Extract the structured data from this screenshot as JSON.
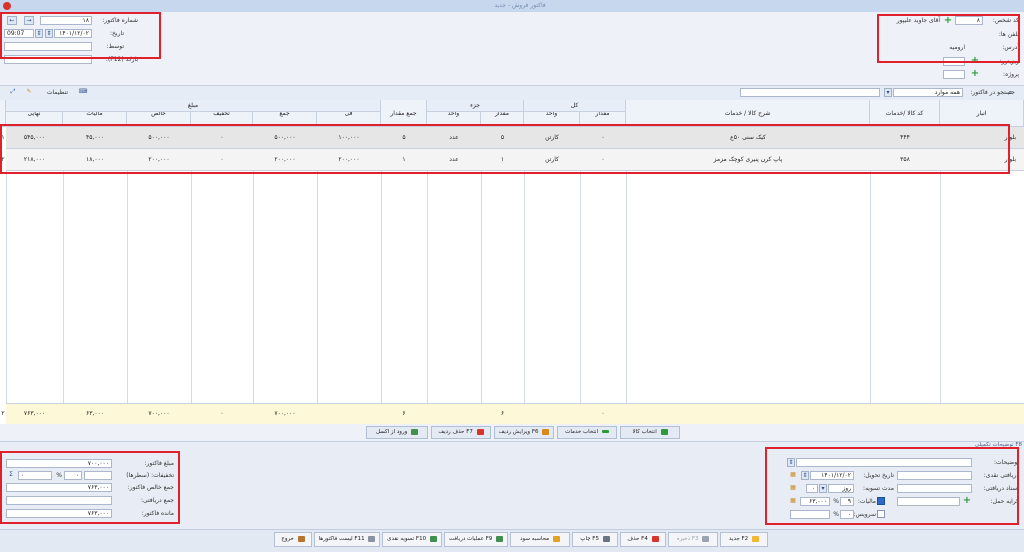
{
  "window": {
    "title": "فاکتور فروش - جدید"
  },
  "header": {
    "invoice_number_label": "شماره فاکتور:",
    "invoice_number": "۱۸",
    "date_label": "تاریخ:",
    "date": "۱۴۰۱/۱۲/۰۲",
    "time": "09:07",
    "by_label": "توسط:",
    "by": "",
    "barcode_label": "بارکد (F12):",
    "barcode": "",
    "person_code_label": "کد شخص:",
    "person_code": "۸",
    "person_name": "آقای جاوید علیپور",
    "phones_label": "تلفن ها:",
    "phones": "",
    "address_label": "آدرس:",
    "address": "ارومیه",
    "visitor_label": "ویزیتور:",
    "visitor": "",
    "project_label": "پروژه:",
    "project": ""
  },
  "searchbar": {
    "settings_label": "تنظیمات",
    "search_label": "جستجو در فاکتور:",
    "scope_value": "همه موارد"
  },
  "table": {
    "group_headers": {
      "kol": "کل",
      "jozz": "جزء",
      "mablagh": "مبلغ"
    },
    "columns": {
      "anbar": "انبار",
      "code": "کد کالا /خدمات",
      "sharh": "شرح کالا / خدمات",
      "kol_megdar": "مقدار",
      "kol_vahed": "واحد",
      "jozz_megdar": "مقدار",
      "jozz_vahed": "واحد",
      "jam_megdar": "جمع مقدار",
      "fi": "فی",
      "jam": "جمع",
      "takhfif": "تخفیف",
      "khales": "خالص",
      "maliat": "مالیات",
      "nahaei": "نهایی"
    },
    "rows": [
      {
        "num": "۱",
        "anbar": "بلوار",
        "code": "۴۴۴",
        "sharh": "کیک سنی ۵۰ع",
        "kol_megdar": "۰",
        "kol_vahed": "کارتن",
        "jozz_megdar": "۵",
        "jozz_vahed": "عدد",
        "jam_megdar": "۵",
        "fi": "۱۰۰,۰۰۰",
        "jam": "۵۰۰,۰۰۰",
        "takhfif": "۰",
        "khales": "۵۰۰,۰۰۰",
        "maliat": "۴۵,۰۰۰",
        "nahaei": "۵۴۵,۰۰۰"
      },
      {
        "num": "۲",
        "anbar": "بلوار",
        "code": "۳۵۸",
        "sharh": "پاپ کرن پنیری کوچک مزمز",
        "kol_megdar": "۰",
        "kol_vahed": "کارتن",
        "jozz_megdar": "۱",
        "jozz_vahed": "عدد",
        "jam_megdar": "۱",
        "fi": "۲۰۰,۰۰۰",
        "jam": "۲۰۰,۰۰۰",
        "takhfif": "۰",
        "khales": "۲۰۰,۰۰۰",
        "maliat": "۱۸,۰۰۰",
        "nahaei": "۲۱۸,۰۰۰"
      }
    ],
    "totals": {
      "count": "۲",
      "kol_megdar": "۰",
      "jozz_megdar": "۶",
      "jam_megdar": "۶",
      "jam": "۷۰۰,۰۰۰",
      "takhfif": "۰",
      "khales": "۷۰۰,۰۰۰",
      "maliat": "۶۳,۰۰۰",
      "nahaei": "۷۶۳,۰۰۰"
    }
  },
  "row_toolbar": {
    "select_goods": "انتخاب کالا",
    "select_services": "انتخاب خدمات",
    "edit_row": "ویرایش ردیف F6",
    "delete_row": "حذف ردیف F7",
    "import_excel": "ورود از اکسل"
  },
  "summary": {
    "amount_label": "مبلغ فاکتور:",
    "amount": "۷۰۰,۰۰۰",
    "discount_label": "تخفیفات: (سطرها)",
    "discount": "۰",
    "discount_pct": "۰",
    "pct_symbol": "%",
    "net_label": "جمع خالص فاکتور:",
    "net": "۷۶۳,۰۰۰",
    "received_label": "جمع دریافتی:",
    "received": "",
    "remaining_label": "مانده فاکتور:",
    "remaining": "۷۶۳,۰۰۰"
  },
  "details": {
    "section_label": "F8 توضیحات تکمیلی",
    "notes_label": "توضیحات:",
    "notes": "",
    "delivery_date_label": "تاریخ تحویل:",
    "delivery_date": "۱۴۰۱/۱۲/۰۲",
    "cash_label": "دریافتی نقدی:",
    "cash": "",
    "settle_label": "مدت تسویه:",
    "settle_value": "۰",
    "settle_unit": "روز",
    "docs_label": "اسناد دریافتی:",
    "docs": "",
    "freight_label": "کرایه حمل:",
    "freight": "",
    "tax_label": "مالیات:",
    "tax_pct": "۹",
    "tax_amount": "۶۳,۰۰۰",
    "service_label": "سرویس:",
    "service_pct": "۰"
  },
  "footer": {
    "new": "جدید F2",
    "save": "ذخیره F3",
    "delete": "حذف F4",
    "print": "چاپ F5",
    "profit": "محاسبه سود",
    "receive_ops": "عملیات دریافت F9",
    "cash_settle": "تسویه نقدی F10",
    "invoice_list": "لیست فاکتورها F11",
    "exit": "خروج"
  },
  "colors": {
    "highlight": "#e0202a",
    "accent": "#2e9a3a",
    "total_row": "#fdf9d8"
  }
}
